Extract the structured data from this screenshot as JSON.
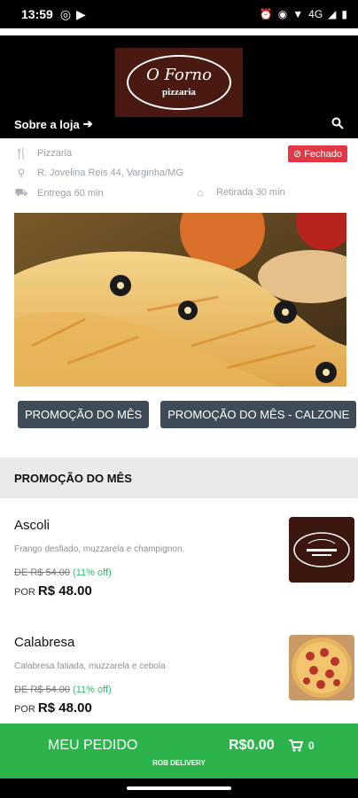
{
  "status_bar": {
    "time": "13:59",
    "right_text": "4G"
  },
  "header": {
    "logo": {
      "name": "O Forno",
      "subtitle": "pizzaria"
    },
    "about_link": "Sobre a loja"
  },
  "store_info": {
    "category": "Pizzaria",
    "address": "R. Jovelina Reis 44, Varginha/MG",
    "delivery": "Entrega 60 min",
    "pickup": "Retirada 30 min",
    "status_badge": "Fechado"
  },
  "promo_buttons": [
    {
      "label": "PROMOÇÃO DO MÊS"
    },
    {
      "label": "PROMOÇÃO DO MÊS - CALZONE"
    }
  ],
  "section": {
    "title": "PROMOÇÃO DO MÊS"
  },
  "products": [
    {
      "name": "Ascoli",
      "description": "Frango desfiado, muzzarela e champignon.",
      "old_price": "DE R$ 54.00",
      "discount": "(11% off)",
      "price_prefix": "POR",
      "price": "R$ 48.00"
    },
    {
      "name": "Calabresa",
      "description": "Calabresa fatiada, muzzarela e cebola",
      "old_price": "DE R$ 54.00",
      "discount": "(11% off)",
      "price_prefix": "POR",
      "price": "R$ 48.00"
    }
  ],
  "order_bar": {
    "label": "MEU PEDIDO",
    "total": "R$0.00",
    "count": "0",
    "footer": "ROB DELIVERY"
  },
  "colors": {
    "accent_green": "#2db34b",
    "badge_red": "#e23744",
    "button_slate": "#3f4b56"
  }
}
